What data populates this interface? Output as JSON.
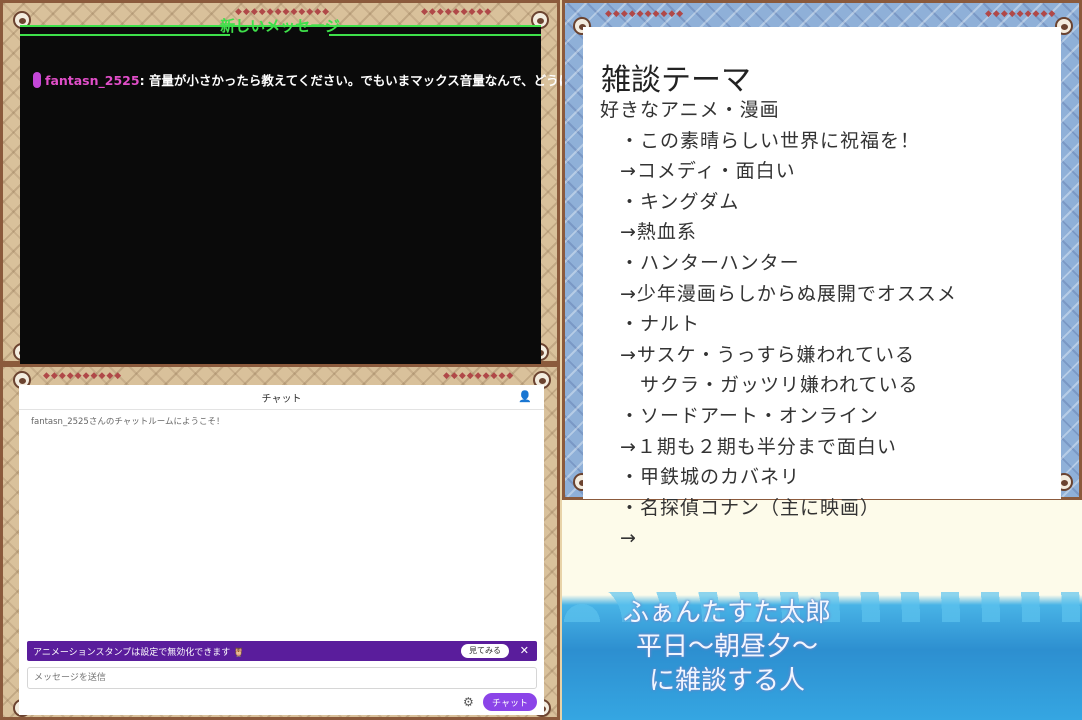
{
  "message_panel": {
    "title": "新しいメッセージ",
    "username": "fantasn_2525",
    "separator": ":",
    "text": " 音量が小さかったら教えてください。でもいまマックス音量なんで、どうにもできません。"
  },
  "chat_panel": {
    "title": "チャット",
    "welcome": "fantasn_2525さんのチャットルームにようこそ！",
    "promo_text": "アニメーションスタンプは設定で無効化できます 🦉",
    "promo_button": "見てみる",
    "promo_close": "✕",
    "input_placeholder": "メッセージを送信",
    "send_button": "チャット",
    "settings_icon": "gear-icon",
    "users_icon": "users-icon"
  },
  "notes_panel": {
    "title": "雑談テーマ",
    "lines": [
      "好きなアニメ・漫画",
      "　・この素晴らしい世界に祝福を！",
      "　→コメディ・面白い",
      "　・キングダム",
      "　→熱血系",
      "　・ハンターハンター",
      "　→少年漫画らしからぬ展開でオススメ",
      "　・ナルト",
      "　→サスケ・うっすら嫌われている",
      "　　サクラ・ガッツリ嫌われている",
      "　・ソードアート・オンライン",
      "　→１期も２期も半分まで面白い",
      "　・甲鉄城のカバネリ",
      "　・名探偵コナン（主に映画）",
      "　→"
    ]
  },
  "caption": {
    "line1": "ふぁんたすた太郎",
    "line2": "平日～朝昼夕～",
    "line3": "に雑談する人"
  },
  "colors": {
    "accent_green": "#3ee04a",
    "username_pink": "#e04ec8",
    "promo_purple": "#5a1d9c",
    "send_purple": "#8b44e8"
  }
}
